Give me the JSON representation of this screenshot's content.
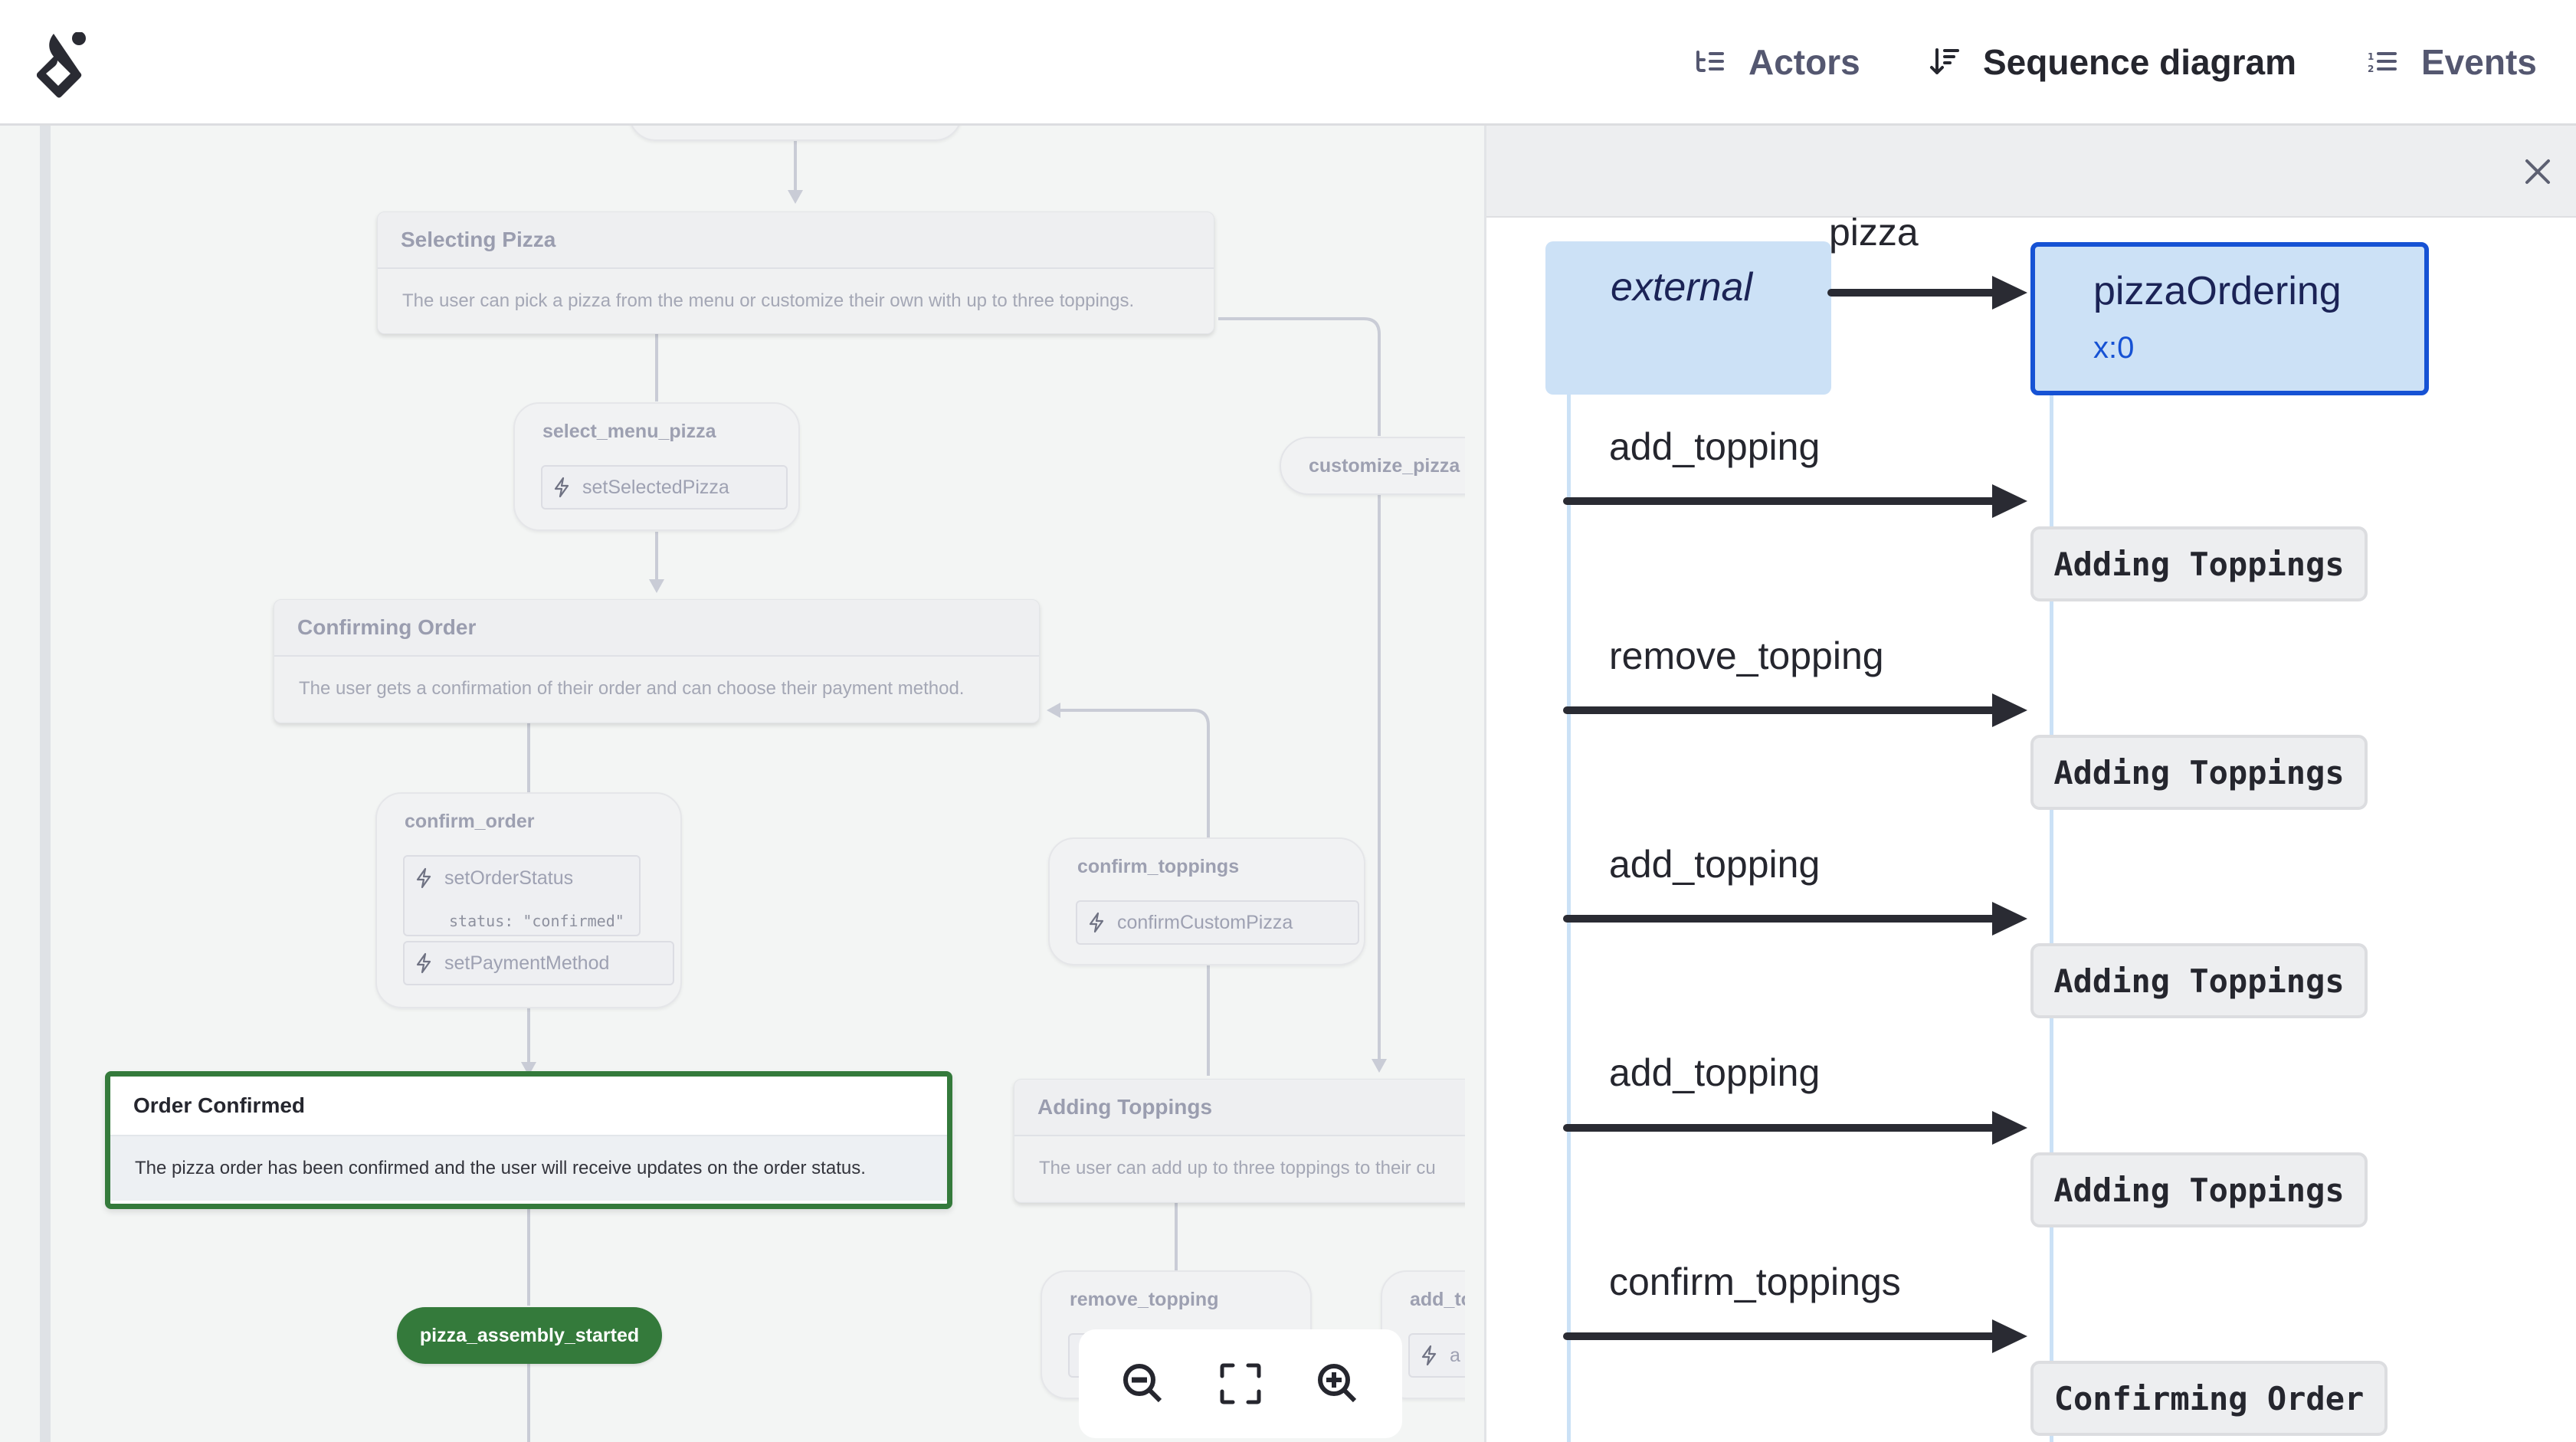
{
  "header": {
    "logo": "stately-logo-icon",
    "nav": [
      {
        "label": "Actors",
        "icon": "actors-list-icon",
        "active": false
      },
      {
        "label": "Sequence diagram",
        "icon": "sequence-sort-icon",
        "active": true
      },
      {
        "label": "Events",
        "icon": "numbered-list-icon",
        "active": false
      }
    ]
  },
  "canvas": {
    "top_node_partial": "",
    "states": {
      "selecting_pizza": {
        "title": "Selecting Pizza",
        "description": "The user can pick a pizza from the menu or customize their own with up to three toppings."
      },
      "confirming_order": {
        "title": "Confirming Order",
        "description": "The user gets a confirmation of their order and can choose their payment method."
      },
      "order_confirmed": {
        "title": "Order Confirmed",
        "description": "The pizza order has been confirmed and the user will receive updates on the order status.",
        "active": true
      },
      "adding_toppings": {
        "title": "Adding Toppings",
        "description": "The user can add up to three toppings to their cu"
      }
    },
    "events": {
      "select_menu_pizza": {
        "label": "select_menu_pizza",
        "actions": [
          {
            "name": "setSelectedPizza"
          }
        ]
      },
      "customize_pizza": {
        "label": "customize_pizza"
      },
      "confirm_order": {
        "label": "confirm_order",
        "actions": [
          {
            "name": "setOrderStatus",
            "param": "status: \"confirmed\""
          },
          {
            "name": "setPaymentMethod"
          }
        ]
      },
      "confirm_toppings": {
        "label": "confirm_toppings",
        "actions": [
          {
            "name": "confirmCustomPizza"
          }
        ]
      },
      "pizza_assembly_started": {
        "label": "pizza_assembly_started"
      },
      "remove_topping": {
        "label": "remove_topping"
      },
      "add_topping": {
        "label": "add_to",
        "action_partial": "a"
      }
    },
    "zoom_controls": {
      "zoom_out": "zoom-out-icon",
      "fit": "fit-view-icon",
      "zoom_in": "zoom-in-icon"
    }
  },
  "panel": {
    "close_icon": "close-icon",
    "actors": [
      {
        "name": "external",
        "style": "italic"
      },
      {
        "name": "pizzaOrdering",
        "id": "x:0",
        "selected": true
      }
    ],
    "first_message_partial": "pizza",
    "messages": [
      {
        "label": "add_topping",
        "snapshot": "Adding Toppings"
      },
      {
        "label": "remove_topping",
        "snapshot": "Adding Toppings"
      },
      {
        "label": "add_topping",
        "snapshot": "Adding Toppings"
      },
      {
        "label": "add_topping",
        "snapshot": "Adding Toppings"
      },
      {
        "label": "confirm_toppings",
        "snapshot": "Confirming Order"
      }
    ]
  },
  "colors": {
    "accent_green": "#347a3b",
    "actor_blue": "#cce1f6",
    "selected_blue": "#1652d4",
    "canvas_bg": "#f3f5f4"
  }
}
